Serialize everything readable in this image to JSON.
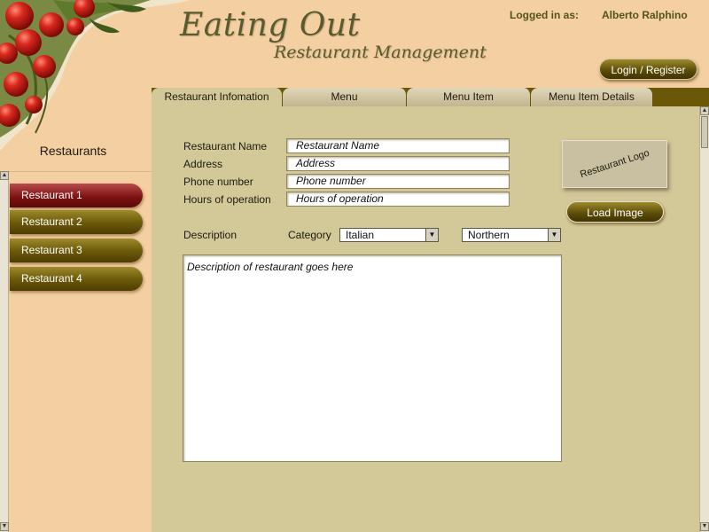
{
  "header": {
    "title_main": "Eating Out",
    "title_sub": "Restaurant Management",
    "logged_in_label": "Logged in as:",
    "logged_in_user": "Alberto Ralphino",
    "login_button": "Login / Register"
  },
  "tabs": [
    {
      "label": "Restaurant Infomation",
      "active": true
    },
    {
      "label": "Menu",
      "active": false
    },
    {
      "label": "Menu Item",
      "active": false
    },
    {
      "label": "Menu Item Details",
      "active": false
    }
  ],
  "sidebar": {
    "title": "Restaurants",
    "items": [
      {
        "label": "Restaurant 1",
        "selected": true
      },
      {
        "label": "Restaurant 2",
        "selected": false
      },
      {
        "label": "Restaurant 3",
        "selected": false
      },
      {
        "label": "Restaurant 4",
        "selected": false
      }
    ]
  },
  "form": {
    "name_label": "Restaurant Name",
    "name_placeholder": "Restaurant Name",
    "address_label": "Address",
    "address_placeholder": "Address",
    "phone_label": "Phone number",
    "phone_placeholder": "Phone number",
    "hours_label": "Hours of operation",
    "hours_placeholder": "Hours of operation",
    "description_label": "Description",
    "category_label": "Category",
    "category_value": "Italian",
    "region_value": "Northern",
    "description_text": "Description of restaurant goes here"
  },
  "logo": {
    "placeholder": "Restaurant Logo",
    "load_button": "Load Image"
  },
  "colors": {
    "background": "#f3cfa2",
    "content_panel": "#d2c898",
    "tab_bar": "#6a5708",
    "button_olive": "#5a4a06",
    "selected_red": "#7a1010"
  }
}
